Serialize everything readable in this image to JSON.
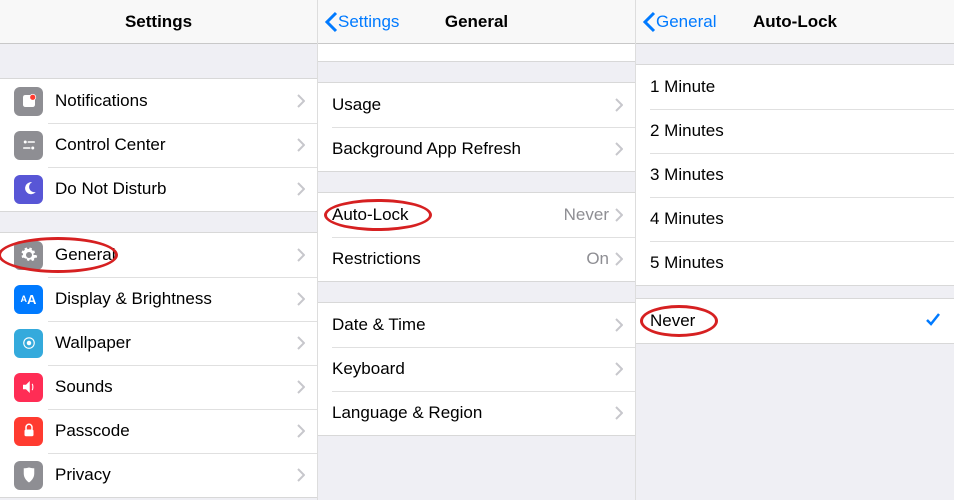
{
  "screen1": {
    "title": "Settings",
    "group1": [
      {
        "label": "Notifications"
      },
      {
        "label": "Control Center"
      },
      {
        "label": "Do Not Disturb"
      }
    ],
    "group2": [
      {
        "label": "General"
      },
      {
        "label": "Display & Brightness"
      },
      {
        "label": "Wallpaper"
      },
      {
        "label": "Sounds"
      },
      {
        "label": "Passcode"
      },
      {
        "label": "Privacy"
      }
    ]
  },
  "screen2": {
    "back": "Settings",
    "title": "General",
    "group1": [
      {
        "label": "Usage"
      },
      {
        "label": "Background App Refresh"
      }
    ],
    "group2": [
      {
        "label": "Auto-Lock",
        "value": "Never"
      },
      {
        "label": "Restrictions",
        "value": "On"
      }
    ],
    "group3": [
      {
        "label": "Date & Time"
      },
      {
        "label": "Keyboard"
      },
      {
        "label": "Language & Region"
      }
    ]
  },
  "screen3": {
    "back": "General",
    "title": "Auto-Lock",
    "options": [
      {
        "label": "1 Minute"
      },
      {
        "label": "2 Minutes"
      },
      {
        "label": "3 Minutes"
      },
      {
        "label": "4 Minutes"
      },
      {
        "label": "5 Minutes"
      }
    ],
    "selected": {
      "label": "Never"
    }
  },
  "icon_colors": {
    "notifications": "#8e8e93",
    "control_center": "#8e8e93",
    "dnd": "#5856d6",
    "general": "#8e8e93",
    "display": "#007aff",
    "wallpaper": "#34aadc",
    "sounds": "#ff2d55",
    "passcode": "#ff3b30",
    "privacy": "#8e8e93"
  }
}
